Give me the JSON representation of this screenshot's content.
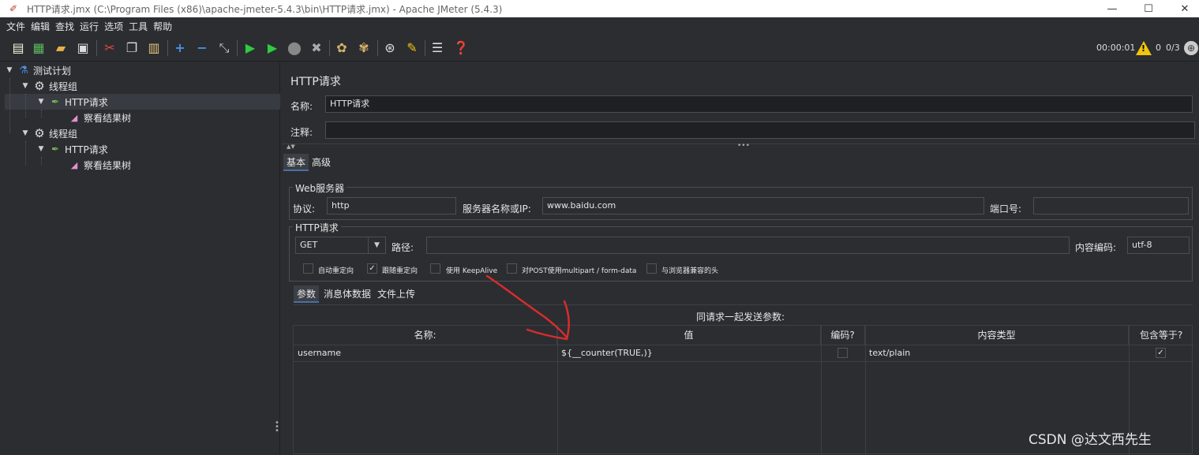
{
  "window": {
    "title": "HTTP请求.jmx (C:\\Program Files (x86)\\apache-jmeter-5.4.3\\bin\\HTTP请求.jmx) - Apache JMeter (5.4.3)",
    "minimize": "—",
    "maximize": "☐",
    "close": "✕"
  },
  "menu": [
    "文件",
    "编辑",
    "查找",
    "运行",
    "选项",
    "工具",
    "帮助"
  ],
  "toolbar": {
    "timer": "00:00:01",
    "warnings": "0",
    "threads": "0/3"
  },
  "tree": {
    "root": "测试计划",
    "group1": "线程组",
    "group1_http": "HTTP请求",
    "group1_listener": "察看结果树",
    "group2": "线程组",
    "group2_http": "HTTP请求",
    "group2_listener": "察看结果树"
  },
  "panel": {
    "title": "HTTP请求",
    "name_label": "名称:",
    "name_value": "HTTP请求",
    "comment_label": "注释:",
    "comment_value": "",
    "tabs": [
      "基本",
      "高级"
    ],
    "web_server_group": "Web服务器",
    "protocol_label": "协议:",
    "protocol_value": "http",
    "server_label": "服务器名称或IP:",
    "server_value": "www.baidu.com",
    "port_label": "端口号:",
    "port_value": "",
    "http_group": "HTTP请求",
    "method": "GET",
    "path_label": "路径:",
    "path_value": "",
    "encoding_label": "内容编码:",
    "encoding_value": "utf-8",
    "checkboxes": [
      {
        "label": "自动重定向",
        "checked": false
      },
      {
        "label": "跟随重定向",
        "checked": true
      },
      {
        "label": "使用 KeepAlive",
        "checked": false
      },
      {
        "label": "对POST使用multipart / form-data",
        "checked": false
      },
      {
        "label": "与浏览器兼容的头",
        "checked": false
      }
    ],
    "subtabs": [
      "参数",
      "消息体数据",
      "文件上传"
    ],
    "params_caption": "同请求一起发送参数:",
    "columns": [
      "名称:",
      "值",
      "编码?",
      "内容类型",
      "包含等于?"
    ],
    "rows": [
      {
        "name": "username",
        "value": "${__counter(TRUE,)}",
        "encode": false,
        "content_type": "text/plain",
        "include_equals": true
      }
    ]
  },
  "watermark": "CSDN @达文西先生"
}
